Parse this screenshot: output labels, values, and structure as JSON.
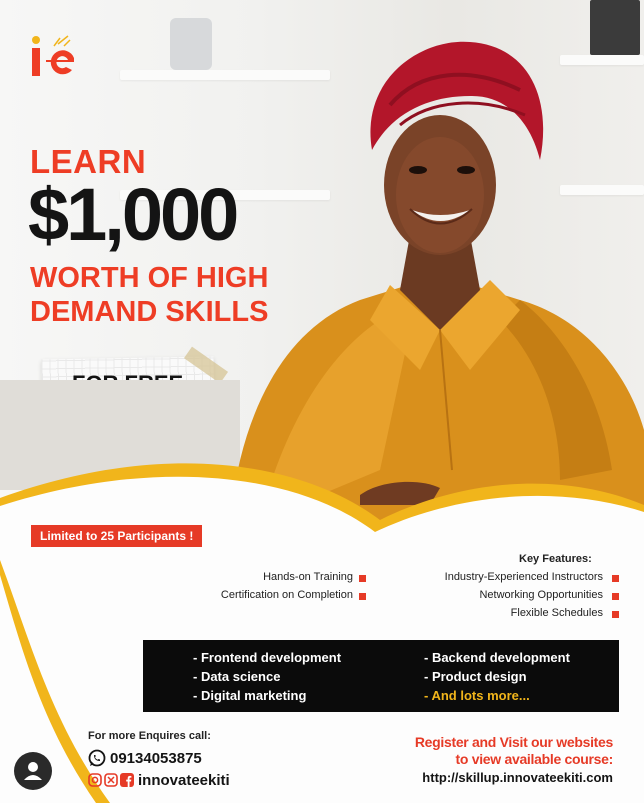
{
  "brand": {
    "colors": {
      "accent": "#ee3d25",
      "gold": "#f1b51b",
      "dark": "#141414"
    }
  },
  "headline": {
    "line1": "LEARN",
    "price": "$1,000",
    "line3": "WORTH OF HIGH",
    "line4": "DEMAND SKILLS",
    "free": "FOR FREE"
  },
  "badge": "Limited to 25 Participants !",
  "key_features": {
    "title": "Key Features:",
    "left": [
      "Hands-on Training",
      "Certification on Completion"
    ],
    "right": [
      "Industry-Experienced Instructors",
      "Networking Opportunities",
      "Flexible Schedules"
    ]
  },
  "courses": {
    "left": [
      "- Frontend development",
      "- Data science",
      "- Digital marketing"
    ],
    "right": [
      "- Backend development",
      "- Product design",
      "- And lots more..."
    ]
  },
  "contact": {
    "enquiries": "For more Enquires call:",
    "phone": "09134053875",
    "handle": "innovateekiti",
    "icons": [
      "whatsapp-icon",
      "instagram-icon",
      "x-icon",
      "facebook-icon"
    ]
  },
  "cta": {
    "line1": "Register and Visit our websites",
    "line2": "to view available course:",
    "url": "http://skillup.innovateekiti.com"
  }
}
